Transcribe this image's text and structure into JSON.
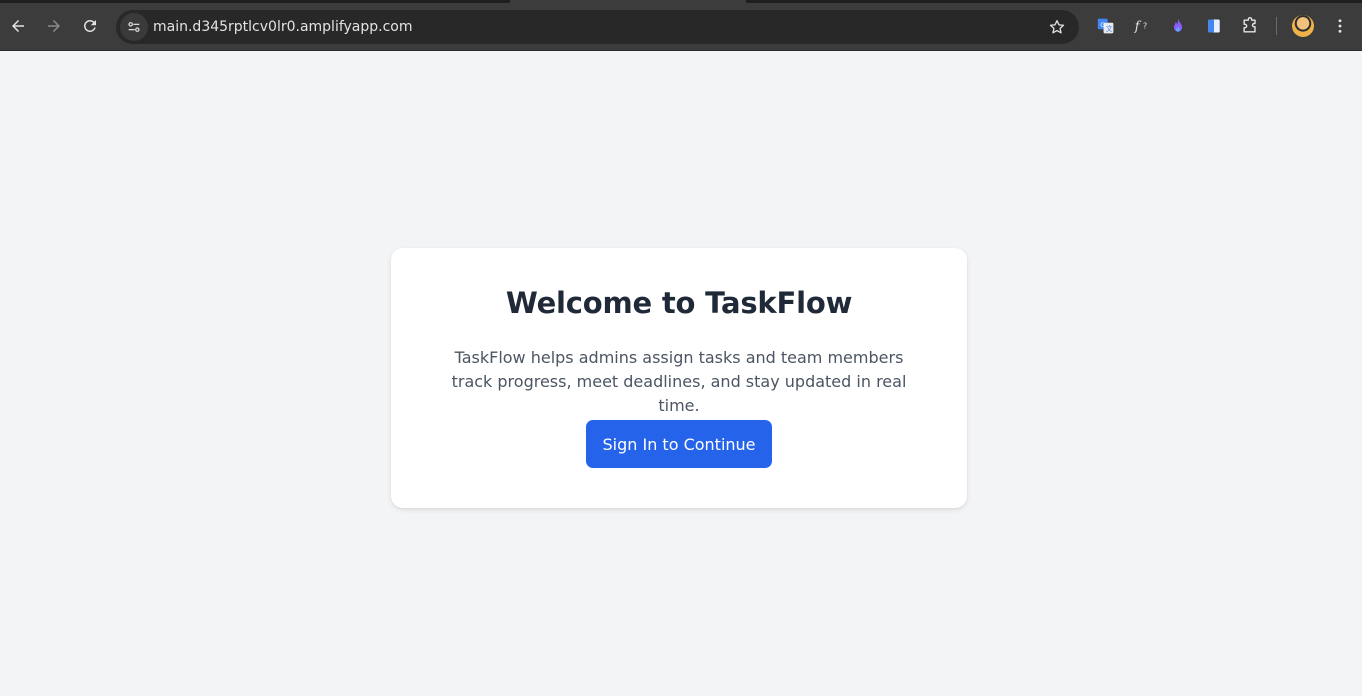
{
  "browser": {
    "url": "main.d345rptlcv0lr0.amplifyapp.com",
    "extensions": [
      "translate-icon",
      "font-finder-icon",
      "purple-flame-icon",
      "blue-book-icon",
      "puzzle-icon"
    ]
  },
  "card": {
    "title": "Welcome to TaskFlow",
    "description": "TaskFlow helps admins assign tasks and team members track progress, meet deadlines, and stay updated in real time.",
    "button_label": "Sign In to Continue"
  },
  "colors": {
    "page_background": "#f3f4f6",
    "button": "#2563eb",
    "title_text": "#1f2937",
    "body_text": "#4b5563"
  }
}
